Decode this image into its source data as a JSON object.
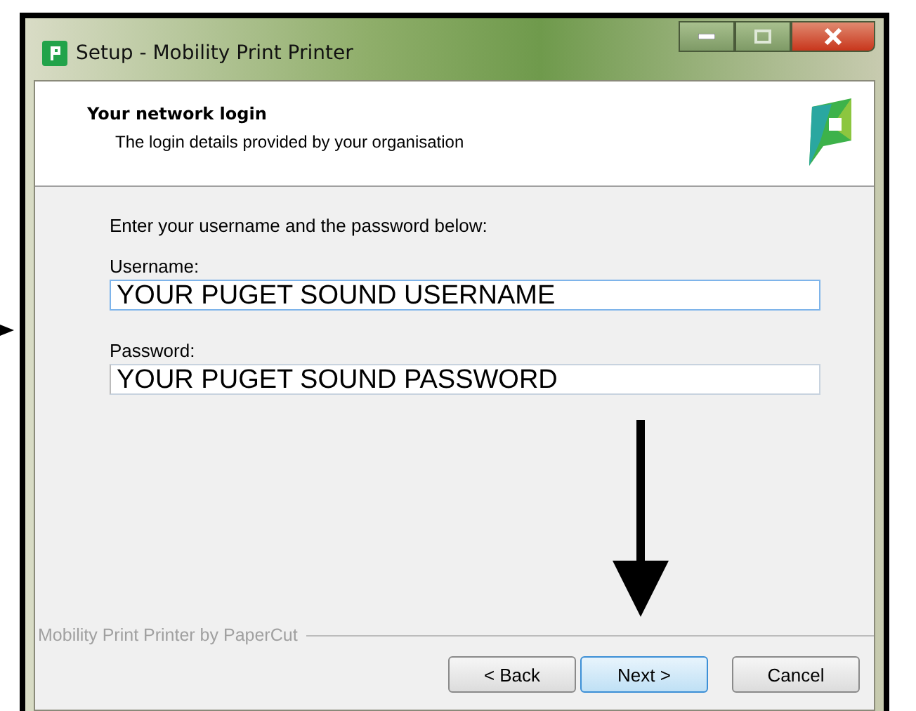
{
  "window": {
    "title": "Setup - Mobility Print Printer"
  },
  "header": {
    "title": "Your network login",
    "subtitle": "The login details provided by your organisation"
  },
  "instruction": "Enter your username and the password below:",
  "fields": [
    {
      "label": "Username:",
      "value": "YOUR PUGET SOUND USERNAME",
      "focused": true
    },
    {
      "label": "Password:",
      "value": "YOUR PUGET SOUND PASSWORD",
      "focused": false
    }
  ],
  "branding": "Mobility Print Printer by PaperCut",
  "buttons": [
    {
      "label": "< Back",
      "default": false
    },
    {
      "label": "Next >",
      "default": true
    },
    {
      "label": "Cancel",
      "default": false
    }
  ]
}
